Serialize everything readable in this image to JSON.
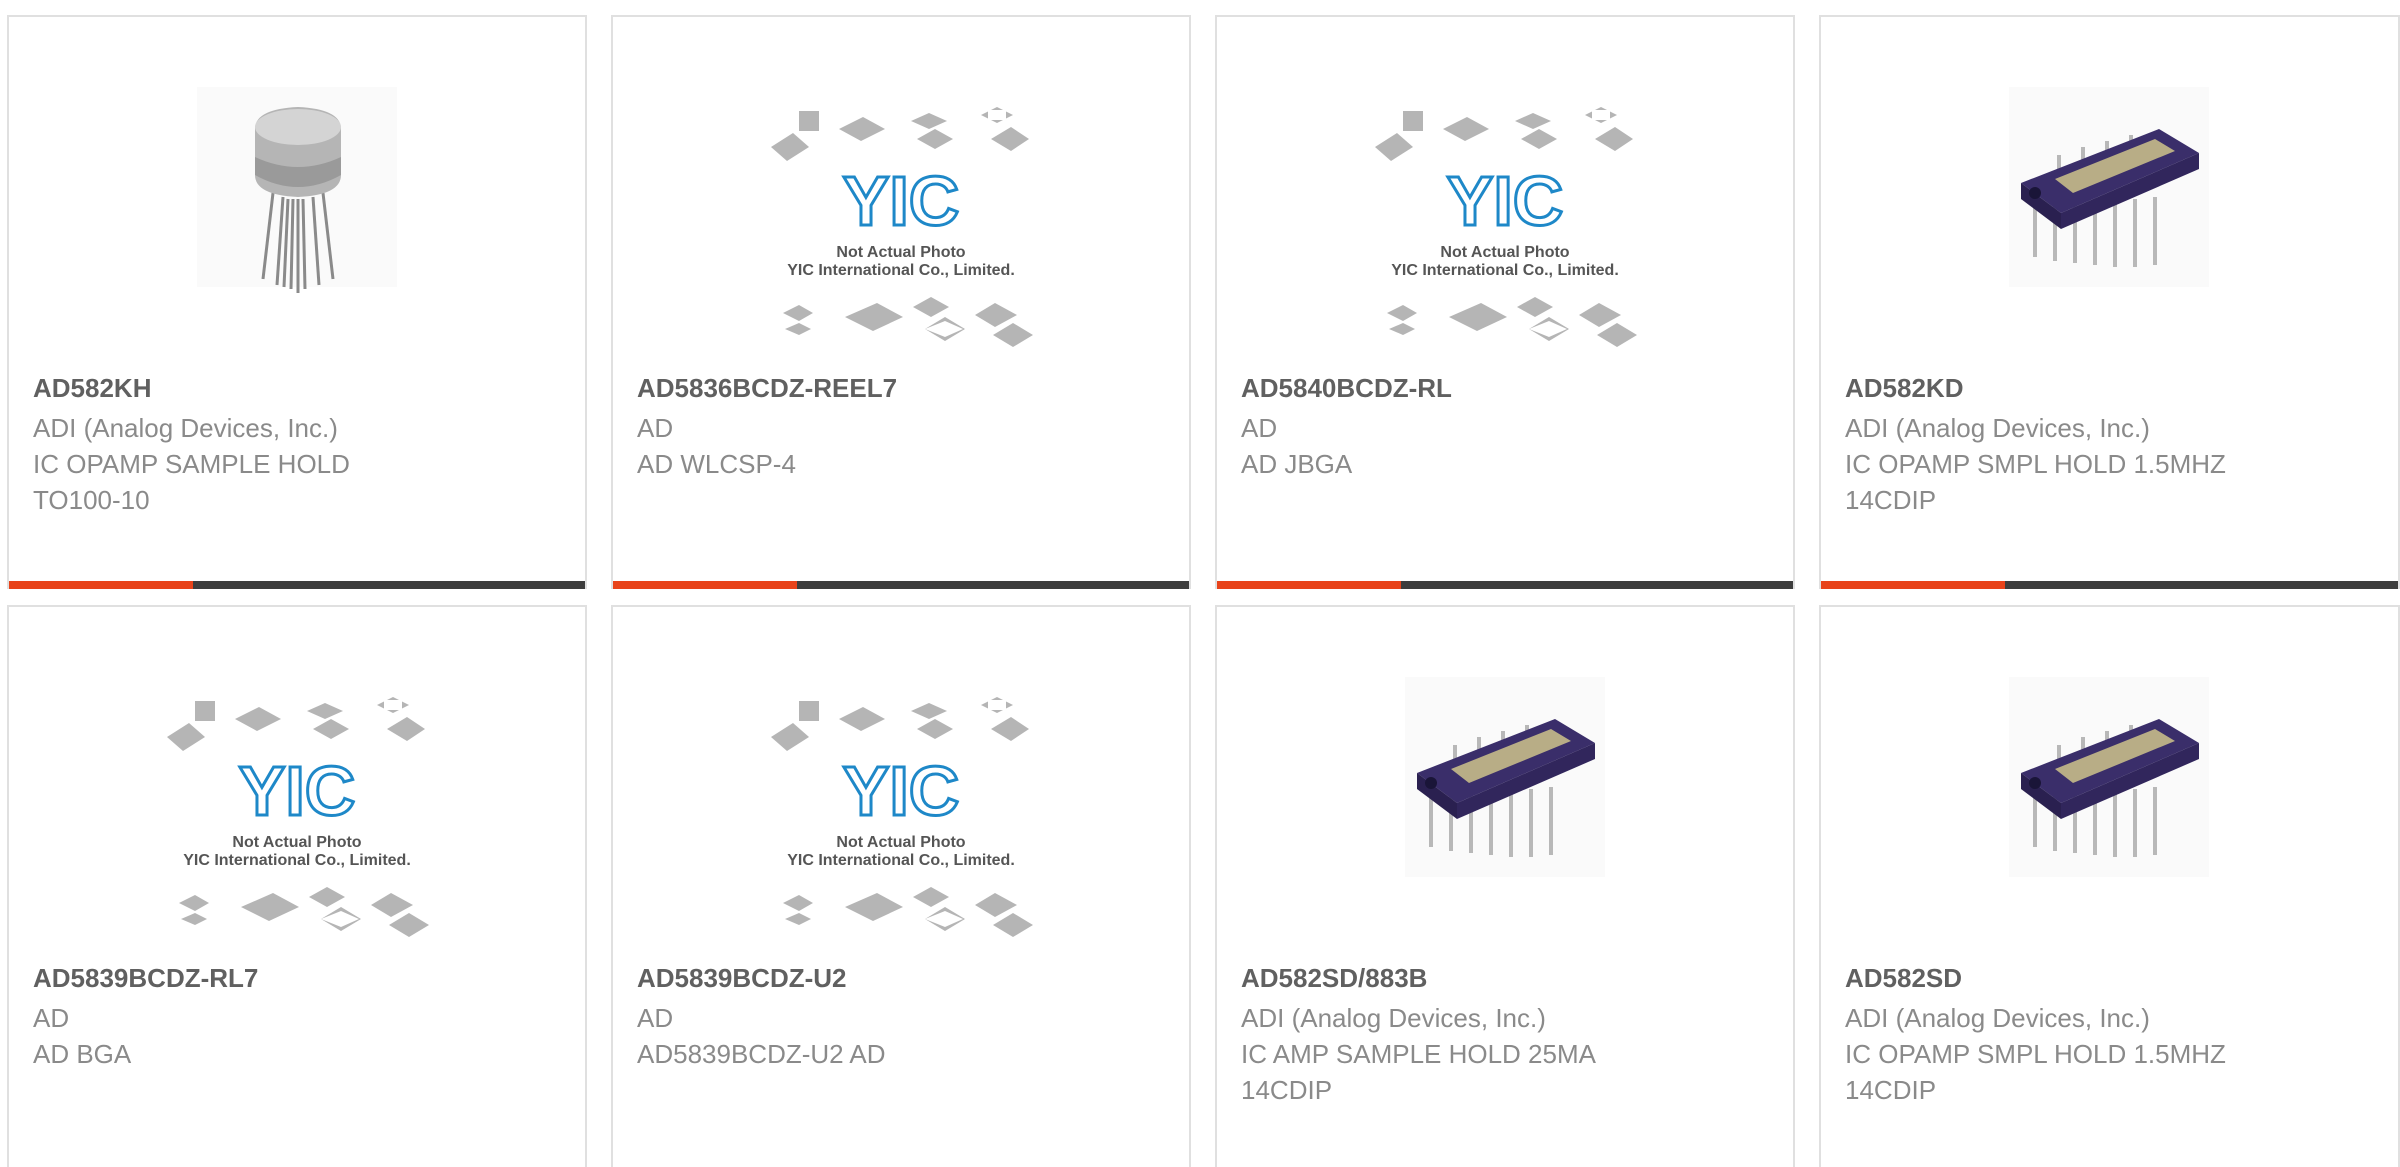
{
  "products": [
    {
      "part_number": "AD582KH",
      "manufacturer": "ADI (Analog Devices, Inc.)",
      "desc_line1": "IC OPAMP SAMPLE HOLD",
      "desc_line2": "TO100-10",
      "image": "metal-can-to100-package-photo"
    },
    {
      "part_number": "AD5836BCDZ-REEL7",
      "manufacturer": "AD",
      "desc_line1": "AD WLCSP-4",
      "desc_line2": "",
      "image": "yic-placeholder-photo"
    },
    {
      "part_number": "AD5840BCDZ-RL",
      "manufacturer": "AD",
      "desc_line1": "AD JBGA",
      "desc_line2": "",
      "image": "yic-placeholder-photo"
    },
    {
      "part_number": "AD582KD",
      "manufacturer": "ADI (Analog Devices, Inc.)",
      "desc_line1": "IC OPAMP SMPL HOLD 1.5MHZ",
      "desc_line2": "14CDIP",
      "image": "cdip-14-package-photo"
    },
    {
      "part_number": "AD5839BCDZ-RL7",
      "manufacturer": "AD",
      "desc_line1": "AD BGA",
      "desc_line2": "",
      "image": "yic-placeholder-photo"
    },
    {
      "part_number": "AD5839BCDZ-U2",
      "manufacturer": "AD",
      "desc_line1": "AD5839BCDZ-U2 AD",
      "desc_line2": "",
      "image": "yic-placeholder-photo"
    },
    {
      "part_number": "AD582SD/883B",
      "manufacturer": "ADI (Analog Devices, Inc.)",
      "desc_line1": "IC AMP SAMPLE HOLD 25MA",
      "desc_line2": "14CDIP",
      "image": "cdip-14-package-photo"
    },
    {
      "part_number": "AD582SD",
      "manufacturer": "ADI (Analog Devices, Inc.)",
      "desc_line1": "IC OPAMP SMPL HOLD 1.5MHZ",
      "desc_line2": "14CDIP",
      "image": "cdip-14-package-photo"
    }
  ],
  "placeholder": {
    "logo": "YIC",
    "caption_line1": "Not Actual Photo",
    "caption_line2": "YIC International Co., Limited."
  },
  "colors": {
    "accent": "#e8431a",
    "bar": "#3d3d3d",
    "logo_blue": "#1e88c8",
    "title_text": "#606060",
    "body_text": "#8a8a8a"
  }
}
